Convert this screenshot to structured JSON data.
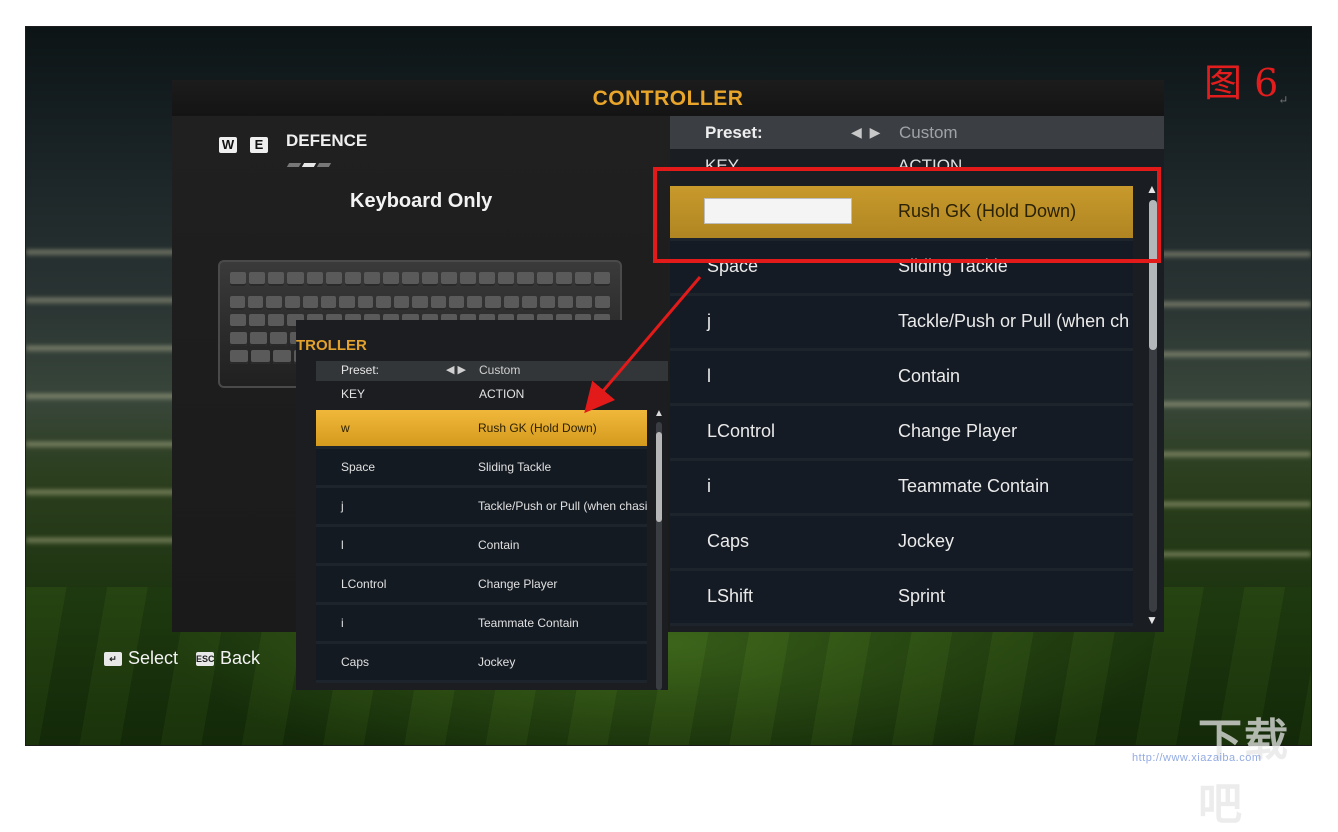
{
  "header": {
    "title": "CONTROLLER"
  },
  "left": {
    "badges": [
      "W",
      "E"
    ],
    "section": "DEFENCE",
    "mode": "Keyboard Only"
  },
  "list": {
    "preset_label": "Preset:",
    "preset_arrows": "◀ ▶",
    "preset_value": "Custom",
    "col_key": "KEY",
    "col_action": "ACTION",
    "rows": [
      {
        "key": "",
        "action": "Rush GK (Hold Down)"
      },
      {
        "key": "Space",
        "action": "Sliding Tackle"
      },
      {
        "key": "j",
        "action": "Tackle/Push or Pull (when chasing)"
      },
      {
        "key": "l",
        "action": "Contain"
      },
      {
        "key": "LControl",
        "action": "Change Player"
      },
      {
        "key": "i",
        "action": "Teammate Contain"
      },
      {
        "key": "Caps",
        "action": "Jockey"
      },
      {
        "key": "LShift",
        "action": "Sprint"
      }
    ]
  },
  "inset": {
    "title": "TROLLER",
    "preset_label": "Preset:",
    "preset_arrows": "◀ ▶",
    "preset_value": "Custom",
    "col_key": "KEY",
    "col_action": "ACTION",
    "rows": [
      {
        "key": "w",
        "action": "Rush GK (Hold Down)"
      },
      {
        "key": "Space",
        "action": "Sliding Tackle"
      },
      {
        "key": "j",
        "action": "Tackle/Push or Pull (when chasing)"
      },
      {
        "key": "l",
        "action": "Contain"
      },
      {
        "key": "LControl",
        "action": "Change Player"
      },
      {
        "key": "i",
        "action": "Teammate Contain"
      },
      {
        "key": "Caps",
        "action": "Jockey"
      }
    ]
  },
  "footer": {
    "select_icon": "enter-icon",
    "select_label": "Select",
    "back_icon_text": "ESC",
    "back_label": "Back"
  },
  "figure_label": "图 6",
  "figure_mark": "↵",
  "watermark": "下载吧",
  "watermark_url": "http://www.xiazaiba.com",
  "colors": {
    "title_gold": "#e8a52a",
    "selected_row": "#c89a2c",
    "annotation_red": "#e21a1a"
  }
}
